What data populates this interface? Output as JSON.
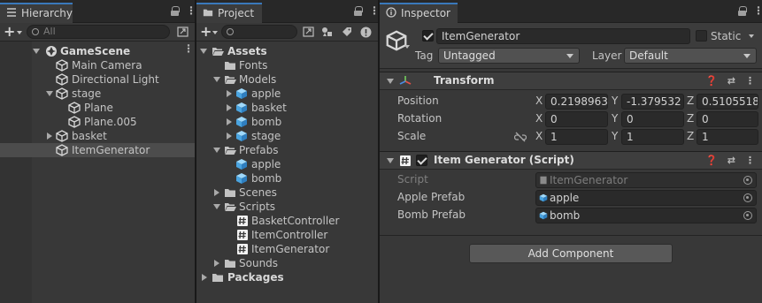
{
  "hierarchy": {
    "tab_label": "Hierarchy",
    "search_placeholder": "All",
    "scene_name": "GameScene",
    "items": [
      {
        "label": "Main Camera"
      },
      {
        "label": "Directional Light"
      },
      {
        "label": "stage"
      },
      {
        "label": "Plane"
      },
      {
        "label": "Plane.005"
      },
      {
        "label": "basket"
      },
      {
        "label": "ItemGenerator"
      }
    ],
    "selected": "ItemGenerator"
  },
  "project": {
    "tab_label": "Project",
    "tree": [
      {
        "label": "Assets"
      },
      {
        "label": "Fonts"
      },
      {
        "label": "Models"
      },
      {
        "label": "apple"
      },
      {
        "label": "basket"
      },
      {
        "label": "bomb"
      },
      {
        "label": "stage"
      },
      {
        "label": "Prefabs"
      },
      {
        "label": "apple"
      },
      {
        "label": "bomb"
      },
      {
        "label": "Scenes"
      },
      {
        "label": "Scripts"
      },
      {
        "label": "BasketController"
      },
      {
        "label": "ItemController"
      },
      {
        "label": "ItemGenerator"
      },
      {
        "label": "Sounds"
      },
      {
        "label": "Packages"
      }
    ]
  },
  "inspector": {
    "tab_label": "Inspector",
    "object_name": "ItemGenerator",
    "active": true,
    "static_label": "Static",
    "static": false,
    "tag_label": "Tag",
    "tag_value": "Untagged",
    "layer_label": "Layer",
    "layer_value": "Default",
    "transform": {
      "title": "Transform",
      "position_label": "Position",
      "rotation_label": "Rotation",
      "scale_label": "Scale",
      "axis_x": "X",
      "axis_y": "Y",
      "axis_z": "Z",
      "position": {
        "x": "0.2198963",
        "y": "-1.379532",
        "z": "0.5105518"
      },
      "rotation": {
        "x": "0",
        "y": "0",
        "z": "0"
      },
      "scale": {
        "x": "1",
        "y": "1",
        "z": "1"
      }
    },
    "script_component": {
      "title": "Item Generator (Script)",
      "enabled": true,
      "script_label": "Script",
      "script_value": "ItemGenerator",
      "apple_prefab_label": "Apple Prefab",
      "apple_prefab_value": "apple",
      "bomb_prefab_label": "Bomb Prefab",
      "bomb_prefab_value": "bomb"
    },
    "add_component_label": "Add Component"
  },
  "colors": {
    "panel_bg": "#383838",
    "selection": "#4c4c4c",
    "tab_accent": "#3a79bb",
    "prefab_blue": "#5ab6ef"
  }
}
